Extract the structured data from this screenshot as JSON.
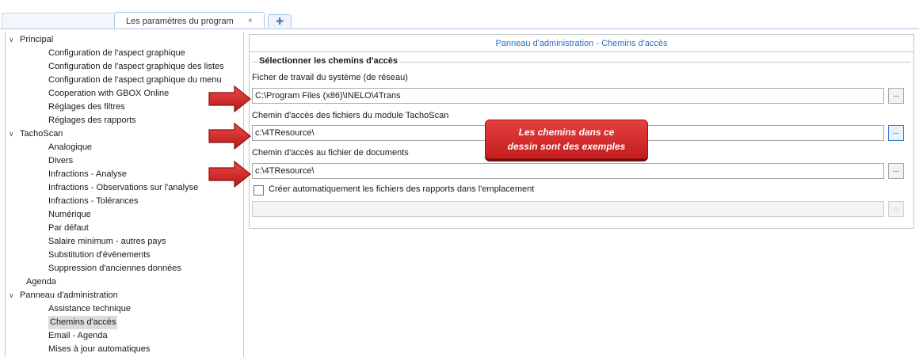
{
  "tabs": {
    "active_label": "Les paramètres du program",
    "close_glyph": "×",
    "new_tab_glyph": "✚"
  },
  "tree": {
    "groups": [
      {
        "label": "Principal",
        "expanded": true,
        "items": [
          "Configuration de l'aspect graphique",
          "Configuration de l'aspect graphique des listes",
          "Configuration de l'aspect graphique du menu",
          "Cooperation with GBOX Online",
          "Réglages des filtres",
          "Réglages des rapports"
        ]
      },
      {
        "label": "TachoScan",
        "expanded": true,
        "items": [
          "Analogique",
          "Divers",
          "Infractions - Analyse",
          "Infractions - Observations sur l'analyse",
          "Infractions - Tolérances",
          "Numérique",
          "Par défaut",
          "Salaire minimum - autres pays",
          "Substitution d'évènements",
          "Suppression d'anciennes données"
        ]
      },
      {
        "label": "Agenda",
        "expanded": false,
        "items": []
      },
      {
        "label": "Panneau d'administration",
        "expanded": true,
        "items": [
          "Assistance technique",
          "Chemins d'accès",
          "Email - Agenda",
          "Mises à jour automatiques"
        ]
      }
    ],
    "selected_item": "Chemins d'accès"
  },
  "panel": {
    "title": "Panneau d'administration - Chemins d'accès",
    "group_title": "Sélectionner les chemins d'accès",
    "fields": [
      {
        "label": "Ficher de travail du système (de réseau)",
        "value": "C:\\Program Files (x86)\\INELO\\4Trans",
        "browse_label": "..."
      },
      {
        "label": "Chemin d'accès des fichiers du module TachoScan",
        "value": "c:\\4TResource\\",
        "browse_label": "..."
      },
      {
        "label": "Chemin d'accès au fichier de documents",
        "value": "c:\\4TResource\\",
        "browse_label": "..."
      }
    ],
    "checkbox": {
      "label": "Créer automatiquement les fichiers des rapports dans l'emplacement",
      "checked": false
    },
    "report_path": {
      "value": "",
      "browse_label": "..."
    }
  },
  "callout": {
    "line1": "Les chemins dans ce",
    "line2": "dessin sont des exemples"
  },
  "colors": {
    "accent_blue": "#2a6ebf",
    "arrow_red": "#d42a2a",
    "callout_red": "#d32b2b"
  }
}
